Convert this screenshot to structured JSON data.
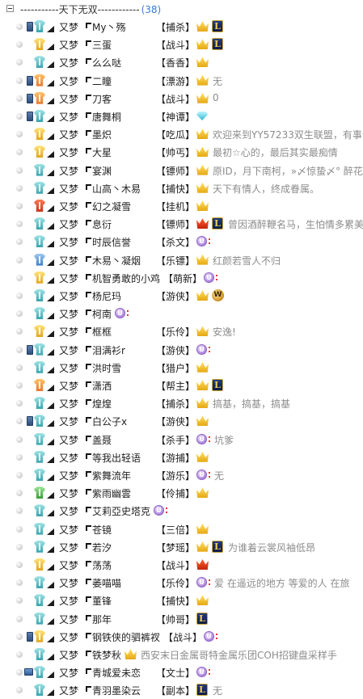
{
  "group": {
    "title": "-----------天下无双------------",
    "count": "(38)",
    "toggle": "collapse"
  },
  "contacts": [
    {
      "group": "又梦",
      "name": "My丶殇",
      "role": "【捕杀】",
      "device": "mobile",
      "shirt": "teal",
      "badges": [
        "gold-crown",
        "lol-icon"
      ],
      "sig": ""
    },
    {
      "group": "又梦",
      "name": "三蛋",
      "role": "【战斗】",
      "device": "",
      "shirt": "gold",
      "badges": [
        "gold-crown",
        "lol-icon"
      ],
      "sig": ""
    },
    {
      "group": "又梦",
      "name": "么么哒",
      "role": "【香香】",
      "device": "",
      "shirt": "teal",
      "badges": [
        "gold-crown"
      ],
      "sig": ""
    },
    {
      "group": "又梦",
      "name": "二瞳",
      "role": "【漂游】",
      "device": "mobile",
      "shirt": "orange",
      "badges": [
        "gold-crown"
      ],
      "sig": "无"
    },
    {
      "group": "又梦",
      "name": "刀客",
      "role": "【战斗】",
      "device": "mobile",
      "shirt": "orange",
      "badges": [
        "gold-crown"
      ],
      "sig": "0"
    },
    {
      "group": "又梦",
      "name": "唐舞桐",
      "role": "【神谭】",
      "device": "mobile",
      "shirt": "teal",
      "badges": [
        "diamond-icon"
      ],
      "sig": ""
    },
    {
      "group": "又梦",
      "name": "墨炽",
      "role": "【吃瓜】",
      "device": "",
      "shirt": "gold",
      "badges": [
        "gold-crown"
      ],
      "sig": "欢迎来到YY57233双生联盟，有事请"
    },
    {
      "group": "又梦",
      "name": "大星",
      "role": "【帅丐】",
      "device": "",
      "shirt": "gold",
      "badges": [
        "gold-crown"
      ],
      "sig": "最初☆心的，最后其实最痴情"
    },
    {
      "group": "又梦",
      "name": "宴渊",
      "role": "【镖师】",
      "device": "",
      "shirt": "teal",
      "badges": [
        "gold-crown"
      ],
      "sig": "原ID，月下南柯，»〆惊蛰〆° 醉花"
    },
    {
      "group": "又梦",
      "name": "山高丶木易",
      "role": "【捕快】",
      "device": "",
      "shirt": "teal",
      "badges": [
        "gold-crown"
      ],
      "sig": "天下有情人，终成眷属。"
    },
    {
      "group": "又梦",
      "name": "幻之凝雪",
      "role": "【挂机】",
      "device": "",
      "shirt": "red",
      "badges": [
        "gold-crown"
      ],
      "sig": ""
    },
    {
      "group": "又梦",
      "name": "息衍",
      "role": "【镖师】",
      "device": "",
      "shirt": "teal",
      "badges": [
        "red-crown",
        "lol-icon"
      ],
      "sig": "曾因酒醉鞭名马，生怕情多累美"
    },
    {
      "group": "又梦",
      "name": "时辰信誉",
      "role": "【杀文】",
      "device": "",
      "shirt": "teal",
      "badges": [
        "vip-icon"
      ],
      "sig": ""
    },
    {
      "group": "又梦",
      "name": "木易丶凝烟",
      "role": "【乐镖】",
      "device": "",
      "shirt": "blue",
      "badges": [
        "gold-crown"
      ],
      "sig": "红颜若雪人不归"
    },
    {
      "group": "又梦",
      "name": "机智勇敢的小鸡",
      "role": "【萌新】",
      "device": "",
      "shirt": "gold",
      "badges": [
        "vip-icon"
      ],
      "sig": ""
    },
    {
      "group": "又梦",
      "name": "杨尼玛",
      "role": "【游侠】",
      "device": "",
      "shirt": "teal",
      "badges": [
        "gold-crown",
        "wow-icon"
      ],
      "sig": ""
    },
    {
      "group": "又梦",
      "name": "柯南",
      "role": "",
      "device": "",
      "shirt": "teal",
      "badges": [
        "vip-icon"
      ],
      "sig": ""
    },
    {
      "group": "又梦",
      "name": "框框",
      "role": "【乐伶】",
      "device": "",
      "shirt": "gold",
      "badges": [
        "gold-crown"
      ],
      "sig": "安逸!"
    },
    {
      "group": "又梦",
      "name": "泪满衫r",
      "role": "【游侠】",
      "device": "mobile",
      "shirt": "teal",
      "badges": [
        "vip-icon"
      ],
      "sig": ""
    },
    {
      "group": "又梦",
      "name": "洪时雪",
      "role": "【猎户】",
      "device": "",
      "shirt": "teal",
      "badges": [
        "gold-crown"
      ],
      "sig": ""
    },
    {
      "group": "又梦",
      "name": "潇洒",
      "role": "【帮主】",
      "device": "",
      "shirt": "orange",
      "badges": [
        "gold-crown",
        "lol-icon"
      ],
      "sig": ""
    },
    {
      "group": "又梦",
      "name": "煌煌",
      "role": "【捕杀】",
      "device": "",
      "shirt": "teal",
      "badges": [
        "gold-crown"
      ],
      "sig": "搞基，搞基，搞基"
    },
    {
      "group": "又梦",
      "name": "白公子x",
      "role": "【游侠】",
      "device": "mobile",
      "shirt": "teal",
      "badges": [
        "gold-crown"
      ],
      "sig": ""
    },
    {
      "group": "又梦",
      "name": "盖聂",
      "role": "【杀手】",
      "device": "",
      "shirt": "teal",
      "badges": [
        "vip-icon"
      ],
      "sig": "坑爹"
    },
    {
      "group": "又梦",
      "name": "等我出轻语",
      "role": "【游捕】",
      "device": "",
      "shirt": "teal",
      "badges": [
        "gold-crown"
      ],
      "sig": ""
    },
    {
      "group": "又梦",
      "name": "紫舞流年",
      "role": "【游乐】",
      "device": "",
      "shirt": "teal",
      "badges": [
        "vip-icon"
      ],
      "sig": "无"
    },
    {
      "group": "又梦",
      "name": "紫雨幽雲",
      "role": "【伶捕】",
      "device": "",
      "shirt": "green",
      "badges": [
        "gold-crown"
      ],
      "sig": ""
    },
    {
      "group": "又梦",
      "name": "艾莉亞史塔克",
      "role": "",
      "device": "",
      "shirt": "teal",
      "badges": [
        "vip-icon"
      ],
      "sig": ""
    },
    {
      "group": "又梦",
      "name": "苍镜",
      "role": "【三倍】",
      "device": "",
      "shirt": "teal",
      "badges": [
        "gold-crown"
      ],
      "sig": ""
    },
    {
      "group": "又梦",
      "name": "若汐",
      "role": "【梦瑶】",
      "device": "",
      "shirt": "teal",
      "badges": [
        "gold-crown",
        "lol-icon"
      ],
      "sig": "为谁着云裳风袖低昂"
    },
    {
      "group": "又梦",
      "name": "荡荡",
      "role": "【战斗】",
      "device": "",
      "shirt": "gold",
      "badges": [
        "red-crown"
      ],
      "sig": ""
    },
    {
      "group": "又梦",
      "name": "萎喵喵",
      "role": "【乐伶】",
      "device": "",
      "shirt": "teal",
      "badges": [
        "vip-icon"
      ],
      "sig": "爱 在遥远的地方 等爱的人 在旅"
    },
    {
      "group": "又梦",
      "name": "董锋",
      "role": "【捕快】",
      "device": "",
      "shirt": "teal",
      "badges": [
        "gold-crown"
      ],
      "sig": ""
    },
    {
      "group": "又梦",
      "name": "那年",
      "role": "【帅哥】",
      "device": "",
      "shirt": "teal",
      "badges": [
        "lol-icon"
      ],
      "sig": ""
    },
    {
      "group": "又梦",
      "name": "钢铁侠的驷裤衩",
      "role": "【战斗】",
      "device": "mobile",
      "shirt": "gold",
      "badges": [
        "vip-icon"
      ],
      "sig": ""
    },
    {
      "group": "又梦",
      "name": "铁梦秋",
      "role": "",
      "device": "",
      "shirt": "teal",
      "badges": [
        "gold-crown"
      ],
      "sig": "西安末日金属哥特金属乐团COH招键盘采样手"
    },
    {
      "group": "又梦",
      "name": "青城爱未恋",
      "role": "【文士】",
      "device": "pc",
      "shirt": "teal",
      "badges": [
        "vip-icon"
      ],
      "sig": ""
    },
    {
      "group": "又梦",
      "name": "青羽墨染云",
      "role": "【副本】",
      "device": "",
      "shirt": "teal",
      "badges": [
        "lol-icon"
      ],
      "sig": "无"
    }
  ]
}
